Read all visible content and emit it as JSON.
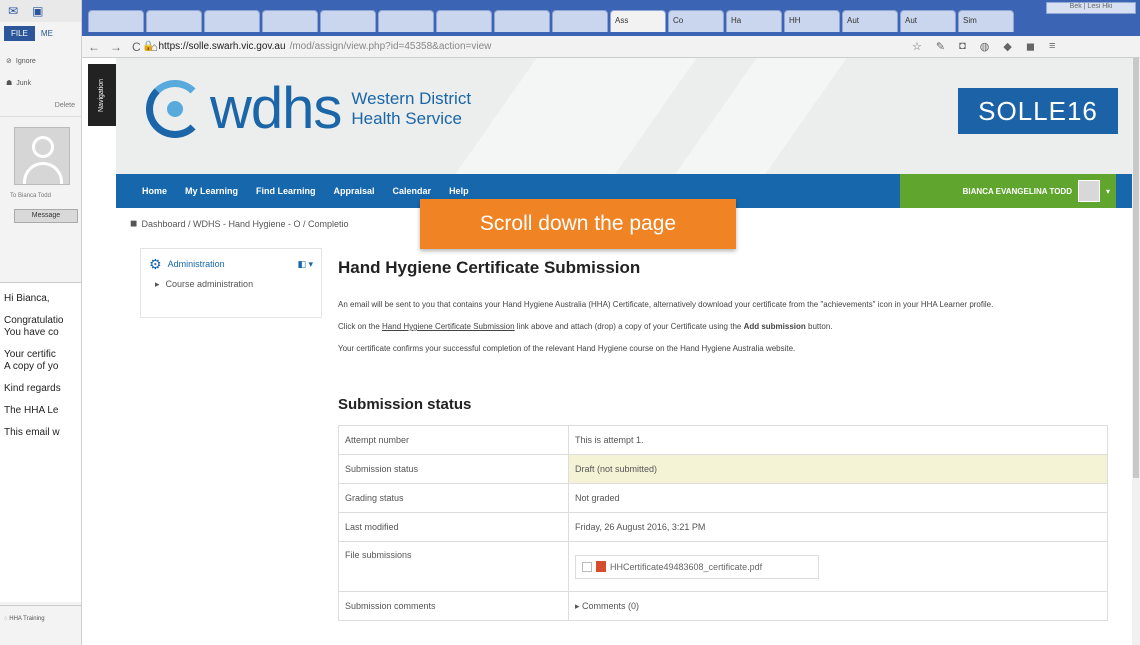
{
  "outlook": {
    "ribbon_file": "FILE",
    "ribbon_tab2": "ME",
    "ignore": "Ignore",
    "junk": "Junk",
    "delete": "Delete",
    "to_line": "To   Bianca Todd",
    "message_btn": "Message",
    "body_lines": [
      "Hi Bianca,",
      "Congratulatio",
      "You have co",
      "Your certific",
      "A copy of yo",
      "Kind regards",
      "The HHA Le",
      "This email w"
    ],
    "footer": "HHA Training"
  },
  "browser": {
    "tab_labels": [
      "",
      "",
      "",
      "",
      "",
      "",
      "",
      "",
      "",
      "Ass",
      "Co",
      "Ha",
      "HH",
      "Aut",
      "Aut",
      "Sim"
    ],
    "window_controls": "Bek | Lesi Hki",
    "url_host": "https://solle.swarh.vic.gov.au",
    "url_path": "/mod/assign/view.php?id=45358&action=view",
    "navigation_label": "Navigation"
  },
  "header": {
    "logo_text": "wdhs",
    "service_line1": "Western District",
    "service_line2": "Health Service",
    "site_badge": "SOLLE16"
  },
  "menu": {
    "items": [
      "Home",
      "My Learning",
      "Find Learning",
      "Appraisal",
      "Calendar",
      "Help"
    ],
    "user_name": "BIANCA EVANGELINA TODD"
  },
  "breadcrumb": "Dashboard / WDHS - Hand Hygiene - O / Completio",
  "overlay_banner": "Scroll down the page",
  "admin_block": {
    "title": "Administration",
    "item": "Course administration"
  },
  "main": {
    "title": "Hand Hygiene Certificate Submission",
    "para1": "An email will be sent to you that contains your Hand Hygiene Australia (HHA) Certificate, alternatively download your certificate from the \"achievements\" icon in your HHA Learner profile.",
    "para2_a": "Click on the ",
    "para2_link": "Hand Hygiene Certificate Submission",
    "para2_b": " link above and attach (drop) a copy of your Certificate using the ",
    "para2_bold": "Add submission",
    "para2_c": " button.",
    "para3": "Your certificate confirms your successful completion of the relevant Hand Hygiene course on the Hand Hygiene Australia website.",
    "status_heading": "Submission status"
  },
  "status_table": [
    {
      "label": "Attempt number",
      "value": "This is attempt 1."
    },
    {
      "label": "Submission status",
      "value": "Draft (not submitted)"
    },
    {
      "label": "Grading status",
      "value": "Not graded"
    },
    {
      "label": "Last modified",
      "value": "Friday, 26 August 2016, 3:21 PM"
    },
    {
      "label": "File submissions",
      "value": "HHCertificate49483608_certificate.pdf"
    },
    {
      "label": "Submission comments",
      "value": "Comments (0)"
    }
  ],
  "colors": {
    "brand_blue": "#1767ad",
    "user_green": "#5fa52e",
    "banner_orange": "#f08323"
  }
}
